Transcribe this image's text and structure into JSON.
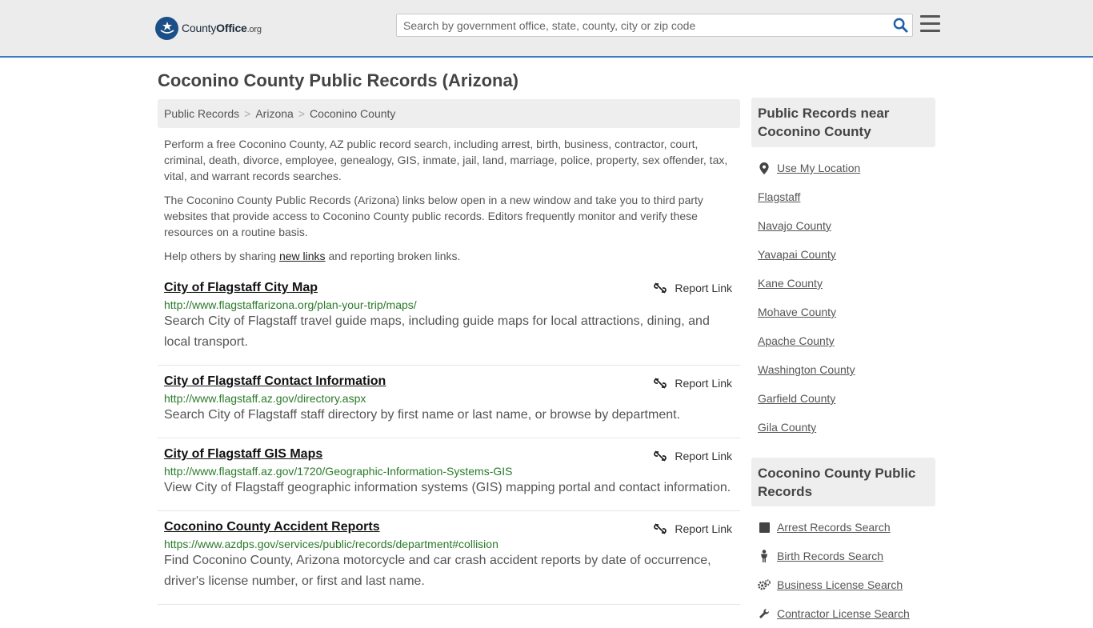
{
  "header": {
    "logo_county": "County",
    "logo_office": "Office",
    "logo_org": ".org",
    "search_placeholder": "Search by government office, state, county, city or zip code",
    "search_icon": "search-icon",
    "menu_icon": "hamburger-menu-icon"
  },
  "page": {
    "title": "Coconino County Public Records (Arizona)"
  },
  "breadcrumb": [
    "Public Records",
    "Arizona",
    "Coconino County"
  ],
  "intro": {
    "p1": "Perform a free Coconino County, AZ public record search, including arrest, birth, business, contractor, court, criminal, death, divorce, employee, genealogy, GIS, inmate, jail, land, marriage, police, property, sex offender, tax, vital, and warrant records searches.",
    "p2": "The Coconino County Public Records (Arizona) links below open in a new window and take you to third party websites that provide access to Coconino County public records. Editors frequently monitor and verify these resources on a routine basis.",
    "p3_before": "Help others by sharing ",
    "p3_link": "new links",
    "p3_after": " and reporting broken links."
  },
  "report_label": "Report Link",
  "records": [
    {
      "title": "City of Flagstaff City Map",
      "url": "http://www.flagstaffarizona.org/plan-your-trip/maps/",
      "desc": "Search City of Flagstaff travel guide maps, including guide maps for local attractions, dining, and local transport."
    },
    {
      "title": "City of Flagstaff Contact Information",
      "url": "http://www.flagstaff.az.gov/directory.aspx",
      "desc": "Search City of Flagstaff staff directory by first name or last name, or browse by department."
    },
    {
      "title": "City of Flagstaff GIS Maps",
      "url": "http://www.flagstaff.az.gov/1720/Geographic-Information-Systems-GIS",
      "desc": "View City of Flagstaff geographic information systems (GIS) mapping portal and contact information."
    },
    {
      "title": "Coconino County Accident Reports",
      "url": "https://www.azdps.gov/services/public/records/department#collision",
      "desc": "Find Coconino County, Arizona motorcycle and car crash accident reports by date of occurrence, driver's license number, or first and last name."
    }
  ],
  "sidebar": {
    "near_title": "Public Records near Coconino County",
    "use_location": "Use My Location",
    "near_items": [
      "Flagstaff",
      "Navajo County",
      "Yavapai County",
      "Kane County",
      "Mohave County",
      "Apache County",
      "Washington County",
      "Garfield County",
      "Gila County"
    ],
    "records_title": "Coconino County Public Records",
    "record_links": [
      {
        "label": "Arrest Records Search",
        "icon": "square-icon"
      },
      {
        "label": "Birth Records Search",
        "icon": "person-icon"
      },
      {
        "label": "Business License Search",
        "icon": "gears-icon"
      },
      {
        "label": "Contractor License Search",
        "icon": "wrench-icon"
      }
    ]
  },
  "colors": {
    "accent": "#3b7cc4",
    "url_green": "#2a7a2a",
    "panel_gray": "#eeeeee"
  }
}
